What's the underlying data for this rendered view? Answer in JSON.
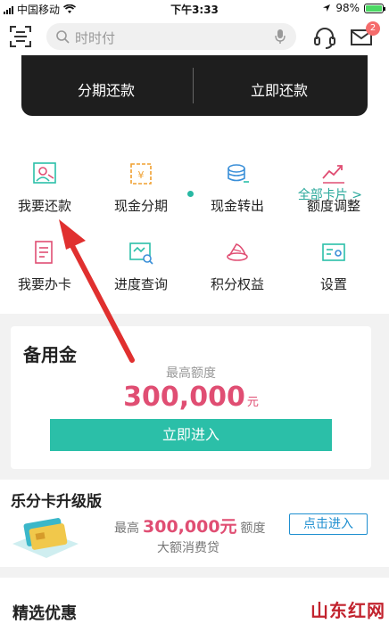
{
  "status_bar": {
    "carrier": "中国移动",
    "time": "下午3:33",
    "battery": "98%",
    "battery_level": 0.98
  },
  "header": {
    "search_placeholder": "时时付",
    "message_badge": "2",
    "icons": [
      "scan-icon",
      "search-icon",
      "microphone-icon",
      "customer-service-icon",
      "mail-icon"
    ]
  },
  "card_actions": {
    "installment_label": "分期还款",
    "repay_now_label": "立即还款"
  },
  "all_cards_link": "全部卡片 >",
  "grid": [
    {
      "label": "我要还款",
      "icon": "repay-icon"
    },
    {
      "label": "现金分期",
      "icon": "cash-installment-icon"
    },
    {
      "label": "现金转出",
      "icon": "cash-transfer-icon"
    },
    {
      "label": "额度调整",
      "icon": "limit-adjust-icon"
    },
    {
      "label": "我要办卡",
      "icon": "apply-card-icon"
    },
    {
      "label": "进度查询",
      "icon": "progress-query-icon"
    },
    {
      "label": "积分权益",
      "icon": "points-icon"
    },
    {
      "label": "设置",
      "icon": "settings-icon"
    }
  ],
  "reserve_fund": {
    "title": "备用金",
    "limit_label": "最高额度",
    "amount": "300,000",
    "unit": "元",
    "button_label": "立即进入"
  },
  "upgrade": {
    "title": "乐分卡升级版",
    "prefix": "最高",
    "amount": "300,000元",
    "suffix": "额度",
    "subtitle": "大额消费贷",
    "button_label": "点击进入"
  },
  "deals": {
    "title": "精选优惠"
  },
  "watermark": "山东红网",
  "colors": {
    "accent": "#2bbfa8",
    "amount": "#e04e73",
    "link": "#1f8fd0",
    "arrow": "#e0302f"
  }
}
